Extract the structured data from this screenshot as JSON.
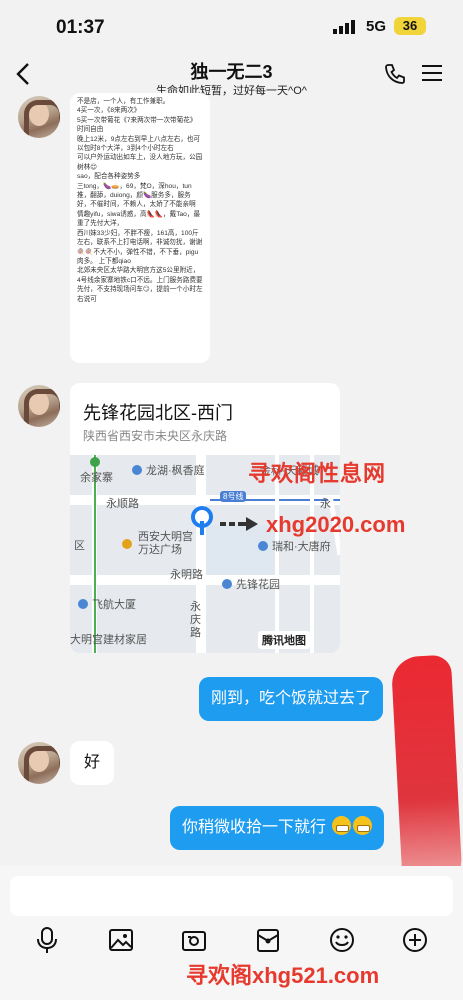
{
  "status": {
    "time": "01:37",
    "network": "5G",
    "battery": "36"
  },
  "header": {
    "title": "独一无二3",
    "subtitle": "生命如此短暂，过好每一天^O^"
  },
  "long_message": {
    "text": "不是店，一个人，有工作兼职。\n4买一次，《8来两次》\n5买一次带葡花《7来两次带一次带葡花》时间自由\n晚上12米，9点左右到早上八点左右，也可以包时8个大洋，3到4个小时左右\n可以户外运动出如车上，没人地方玩，公园树林😊\nsao，配合各种姿势多\n三tong，🍆🥧，69，梵O，深hou，tun推，翻舔，duiong，颜🍆服务多，服务好，不催时间，不赖人，太娇了不能亲啊\n情趣yifu，siwa诱惑，高👠👠，戴Tao，最重了先付大洋，\n西川妹33少妇，不胖不瘦，161高，100斤左右，联系不上打电话啊，非诚勿扰，谢谢\n🍭🍭不大不小，弹性不错，不下垂，pigu肉多。  上下都qiao\n北郊未央区太华路大明宫方这5公里附近，4号线余家寨地铁c口不远。上门服务路费要先付，不支持现场问车😏，提前一个小时左右说可"
  },
  "location": {
    "title": "先锋花园北区-西门",
    "address": "陕西省西安市未央区永庆路",
    "map_labels": {
      "yujiazhai": "余家寨",
      "longhu": "龙湖·枫香庭",
      "jinke": "金科·天籁城",
      "yongshun": "永顺路",
      "line8": "8号线",
      "yong": "永",
      "qu": "区",
      "wanda": "西安大明宫\n万达广场",
      "ruihe": "瑞和·大唐府",
      "yongming": "永明路",
      "xianfeng": "先锋花园",
      "feihang": "飞航大厦",
      "yongqing": "永\n庆\n路",
      "jiancai": "大明宫建材家居",
      "map_logo": "腾讯地图"
    }
  },
  "watermark": {
    "line1": "寻欢阁性息网",
    "line2": "xhg2020.com",
    "line3": "寻欢阁xhg521.com"
  },
  "messages": {
    "out1": "刚到，吃个饭就过去了",
    "in1": "好",
    "out2": "你稍微收拾一下就行"
  },
  "toolbar": {
    "icons": [
      "microphone-icon",
      "image-icon",
      "camera-icon",
      "red-packet-icon",
      "emoji-icon",
      "plus-icon"
    ]
  }
}
